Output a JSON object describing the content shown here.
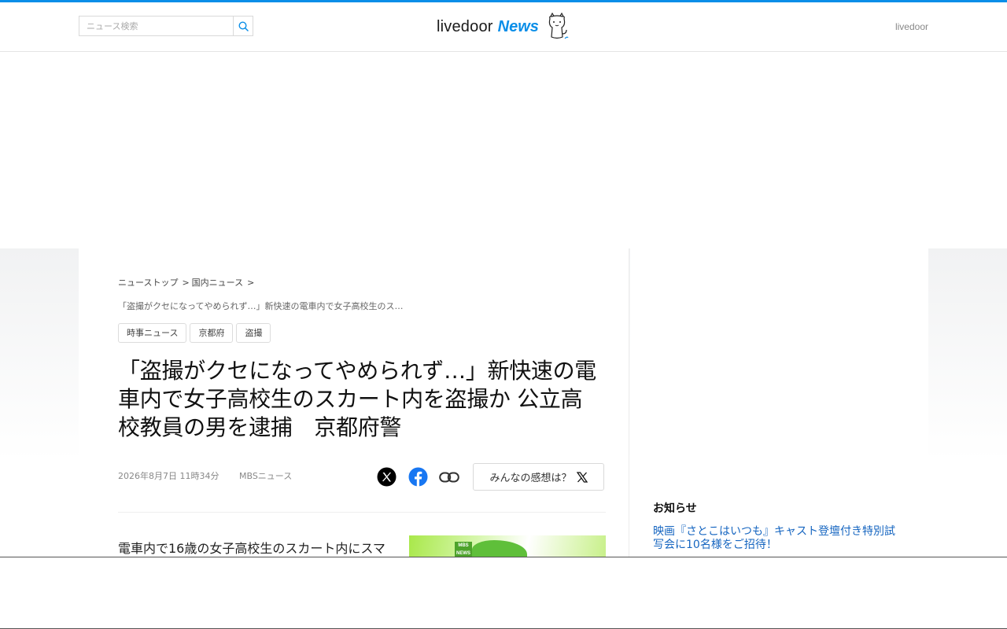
{
  "header": {
    "search_placeholder": "ニュース検索",
    "logo_text": "livedoor",
    "logo_accent": "News",
    "right_link": "livedoor"
  },
  "breadcrumb": {
    "items": [
      "ニューストップ",
      "国内ニュース"
    ],
    "separator": ">",
    "current": "「盗撮がクセになってやめられず…」新快速の電車内で女子高校生のス…"
  },
  "tags": [
    "時事ニュース",
    "京都府",
    "盗撮"
  ],
  "article": {
    "title": "「盗撮がクセになってやめられず…」新快速の電車内で女子高校生のスカート内を盗撮か 公立高校教員の男を逮捕　京都府警",
    "date": "2026年8月7日 11時34分",
    "source": "MBSニュース",
    "lead": "電車内で16歳の女子高校生のスカート内にスマ",
    "thumb_label": "MBS NEWS"
  },
  "share": {
    "icons": [
      "x-icon",
      "facebook-icon",
      "link-icon"
    ],
    "react_label": "みんなの感想は？"
  },
  "sidebar": {
    "notice_heading": "お知らせ",
    "notice_item": "映画『さとこはいつも』キャスト登壇付き特別試写会に10名様をご招待！"
  },
  "colors": {
    "accent": "#0a8ee8",
    "link": "#1565c0",
    "facebook": "#1877f2"
  }
}
